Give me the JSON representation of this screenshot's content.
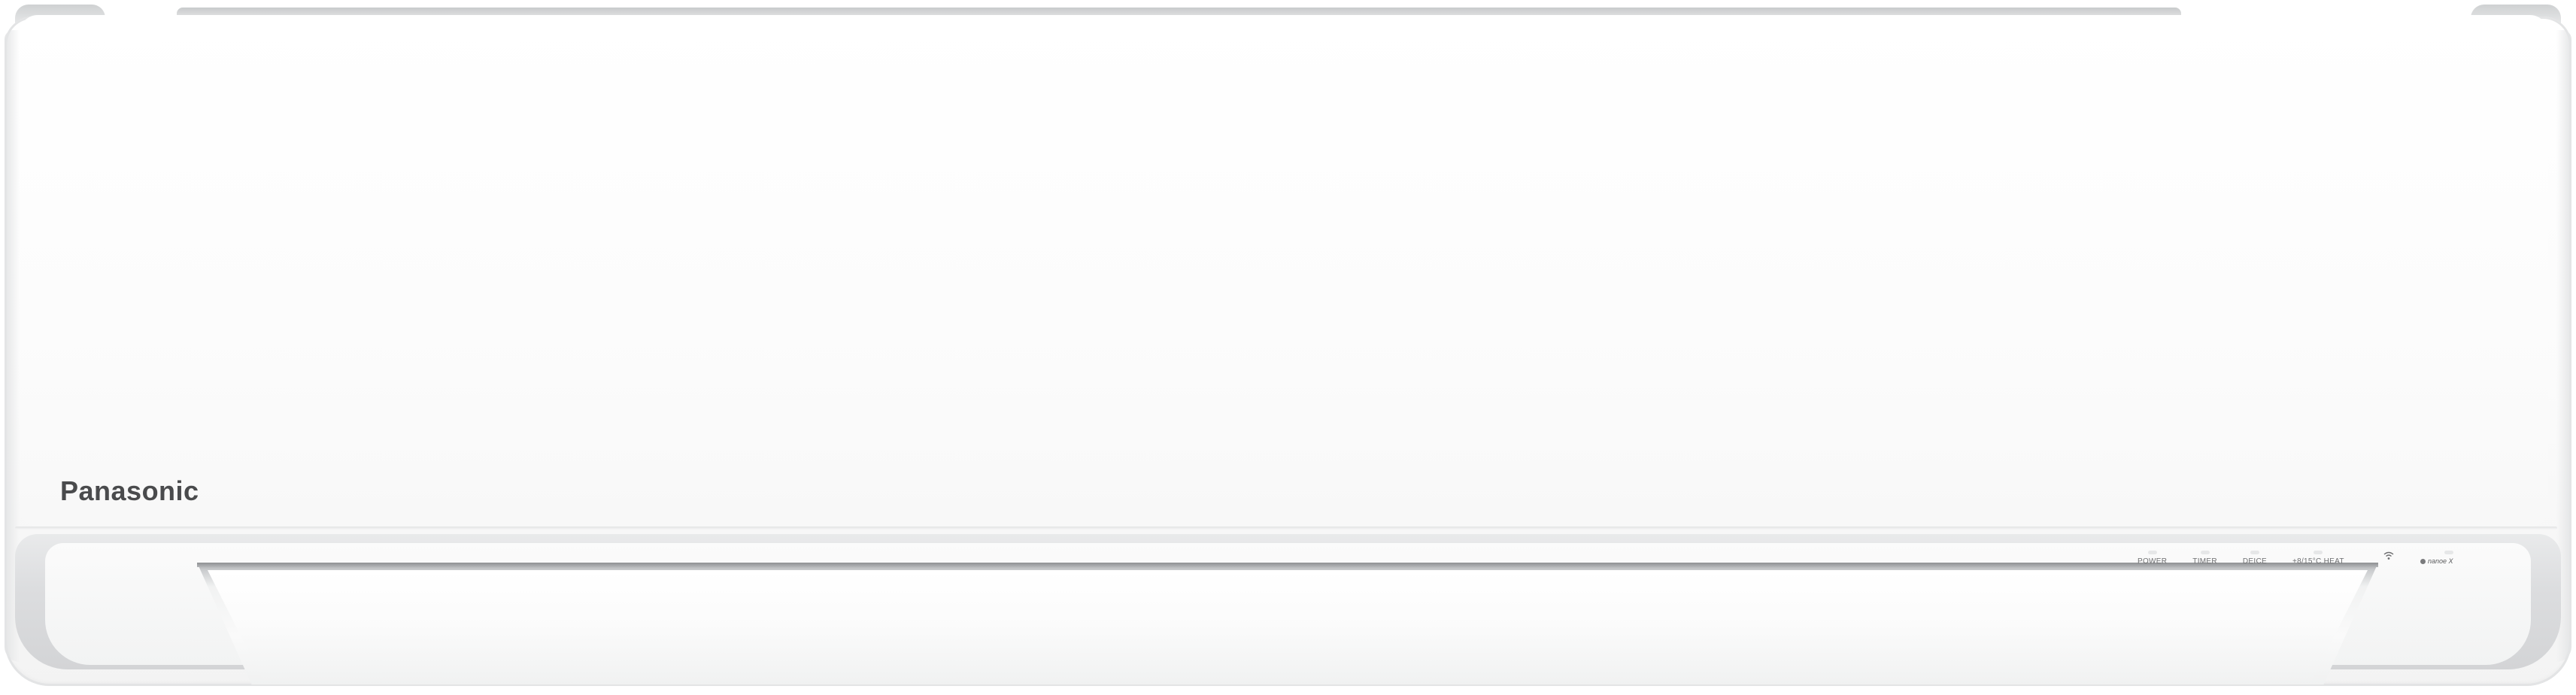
{
  "product": {
    "brand": "Panasonic",
    "type": "wall-mounted air conditioner indoor unit"
  },
  "indicator_panel": {
    "items": [
      {
        "label": "POWER"
      },
      {
        "label": "TIMER"
      },
      {
        "label": "DEICE"
      },
      {
        "label": "+8/15°C HEAT"
      }
    ],
    "wifi_icon": "wifi-icon",
    "nanoe_label": "nanoe X"
  },
  "colors": {
    "body": "#ffffff",
    "frame": "#d3d4d6",
    "brand_text": "#4a4b4d"
  }
}
